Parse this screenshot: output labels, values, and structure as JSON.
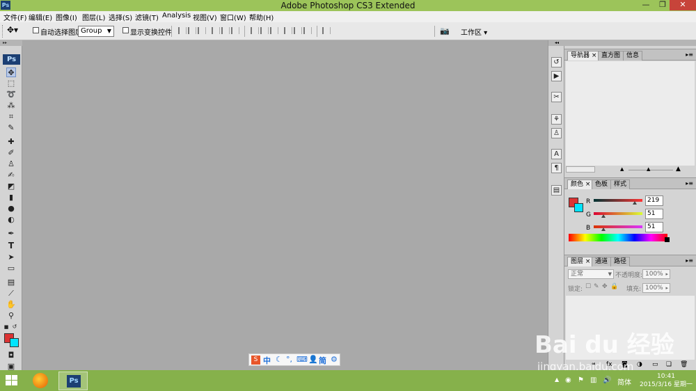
{
  "window": {
    "title": "Adobe Photoshop CS3 Extended",
    "logo": "Ps",
    "controls": [
      "minimize-icon",
      "restore-icon",
      "close-icon"
    ]
  },
  "menubar": {
    "items": [
      "文件(F)",
      "编辑(E)",
      "图像(I)",
      "图层(L)",
      "选择(S)",
      "滤镜(T)",
      "Analysis",
      "视图(V)",
      "窗口(W)",
      "帮助(H)"
    ]
  },
  "options": {
    "auto_select_label": "自动选择图层",
    "auto_select_checked": false,
    "group_value": "Group",
    "show_transform_label": "显示变换控件",
    "show_transform_checked": false,
    "workspace_label": "工作区"
  },
  "toolbox": {
    "badge": "Ps",
    "tools": [
      "move-icon",
      "marquee-icon",
      "lasso-icon",
      "magic-wand-icon",
      "crop-icon",
      "slice-icon",
      "healing-brush-icon",
      "brush-icon",
      "clone-stamp-icon",
      "history-brush-icon",
      "eraser-icon",
      "gradient-icon",
      "blur-icon",
      "dodge-icon",
      "pen-icon",
      "type-icon",
      "path-selection-icon",
      "shape-icon",
      "notes-icon",
      "eyedropper-icon",
      "hand-icon",
      "zoom-icon"
    ],
    "type_tool_label": "T",
    "foreground_color": "#db3333",
    "background_color": "#00e5ff"
  },
  "navigator_panel": {
    "tabs": [
      "导航器",
      "直方图",
      "信息"
    ]
  },
  "color_panel": {
    "tabs": [
      "颜色",
      "色板",
      "样式"
    ],
    "channels": [
      {
        "label": "R",
        "value": "219"
      },
      {
        "label": "G",
        "value": "51"
      },
      {
        "label": "B",
        "value": "51"
      }
    ]
  },
  "layers_panel": {
    "tabs": [
      "图层",
      "通道",
      "路径"
    ],
    "blend_mode": "正常",
    "opacity_label": "不透明度:",
    "opacity_value": "100%",
    "lock_label": "锁定:",
    "fill_label": "填充:",
    "fill_value": "100%"
  },
  "ime": {
    "mode": "中",
    "simplified": "简"
  },
  "taskbar": {
    "language": "简体",
    "time": "10:41",
    "date": "2015/3/16 星期一"
  },
  "watermark": {
    "logo": "Bai du 经验",
    "url": "jingyan.baidu.com"
  }
}
